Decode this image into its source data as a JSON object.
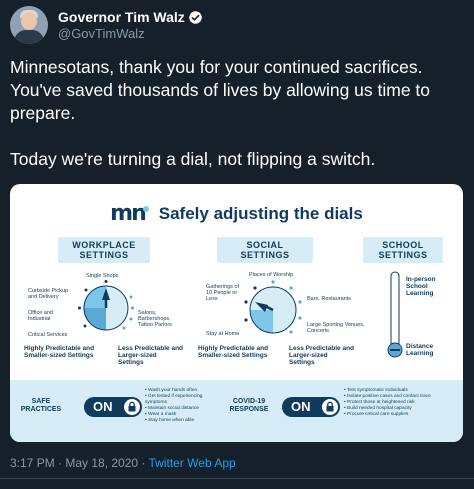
{
  "author": {
    "display_name": "Governor Tim Walz",
    "handle": "@GovTimWalz"
  },
  "tweet": {
    "paragraph1": "Minnesotans, thank you for your continued sacrifices. You've saved thousands of lives by allowing us time to prepare.",
    "paragraph2": "Today we're turning a dial, not flipping a switch."
  },
  "graphic": {
    "logo_text": "mn",
    "title": "Safely adjusting the dials",
    "workplace": {
      "header_line1": "WORKPLACE",
      "header_line2": "SETTINGS",
      "top": "Single Shops",
      "left1": "Curbside Pickup and Delivery",
      "left2": "Office and Industrial",
      "left3": "Critical Services",
      "right1": "Salons, Barbershops, Tattoo Parlors",
      "bottom_left": "Highly Predictable and Smaller-sized Settings",
      "bottom_right": "Less Predictable and Larger-sized Settings"
    },
    "social": {
      "header_line1": "SOCIAL",
      "header_line2": "SETTINGS",
      "top": "Places of Worship",
      "left1": "Gatherings of 10 People or Less",
      "left2": "Stay at Home",
      "right1": "Bars, Restaurants",
      "right2": "Large Sporting Venues, Concerts",
      "bottom_left": "Highly Predictable and Smaller-sized Settings",
      "bottom_right": "Less Predictable and Larger-sized Settings"
    },
    "school": {
      "header_line1": "SCHOOL",
      "header_line2": "SETTINGS",
      "top": "In-person School Learning",
      "bottom": "Distance Learning"
    },
    "safe_practices": {
      "label_line1": "SAFE",
      "label_line2": "PRACTICES",
      "toggle": "ON",
      "bullets": [
        "Wash your hands often",
        "Get tested if experiencing symptoms",
        "Maintain social distance",
        "Wear a mask",
        "Stay home when able"
      ]
    },
    "covid_response": {
      "label_line1": "COVID-19",
      "label_line2": "RESPONSE",
      "toggle": "ON",
      "bullets": [
        "Test symptomatic individuals",
        "Isolate positive cases and contact trace",
        "Protect those at heightened risk",
        "Build needed hospital capacity",
        "Procure critical care supplies"
      ]
    },
    "colors": {
      "navy": "#0f3b5c",
      "light_blue": "#d6edf8",
      "accent_blue": "#7ec7ea"
    }
  },
  "meta": {
    "time_date": "3:17 PM · May 18, 2020 · ",
    "source": "Twitter Web App"
  }
}
